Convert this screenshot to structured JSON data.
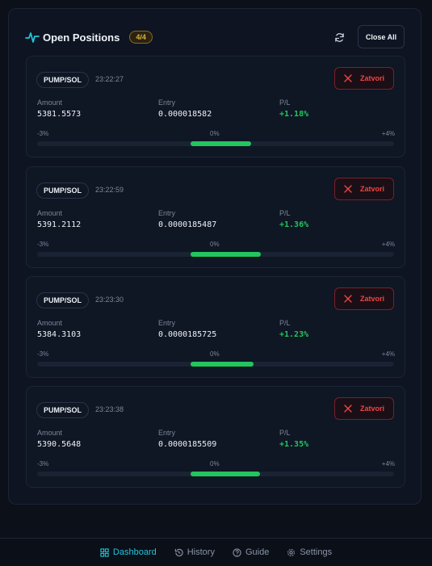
{
  "header": {
    "title": "Open Positions",
    "count": "4/4",
    "close_all_label": "Close All"
  },
  "positions": [
    {
      "pair": "PUMP/SOL",
      "time": "23:22:27",
      "amount_label": "Amount",
      "amount": "5381.5573",
      "entry_label": "Entry",
      "entry": "0.000018582",
      "pl_label": "P/L",
      "pl": "+1.18%",
      "pl_pct": 1.18,
      "close_label": "Zatvori",
      "scale_min": "-3%",
      "scale_zero": "0%",
      "scale_max": "+4%"
    },
    {
      "pair": "PUMP/SOL",
      "time": "23:22:59",
      "amount_label": "Amount",
      "amount": "5391.2112",
      "entry_label": "Entry",
      "entry": "0.0000185487",
      "pl_label": "P/L",
      "pl": "+1.36%",
      "pl_pct": 1.36,
      "close_label": "Zatvori",
      "scale_min": "-3%",
      "scale_zero": "0%",
      "scale_max": "+4%"
    },
    {
      "pair": "PUMP/SOL",
      "time": "23:23:30",
      "amount_label": "Amount",
      "amount": "5384.3103",
      "entry_label": "Entry",
      "entry": "0.0000185725",
      "pl_label": "P/L",
      "pl": "+1.23%",
      "pl_pct": 1.23,
      "close_label": "Zatvori",
      "scale_min": "-3%",
      "scale_zero": "0%",
      "scale_max": "+4%"
    },
    {
      "pair": "PUMP/SOL",
      "time": "23:23:38",
      "amount_label": "Amount",
      "amount": "5390.5648",
      "entry_label": "Entry",
      "entry": "0.0000185509",
      "pl_label": "P/L",
      "pl": "+1.35%",
      "pl_pct": 1.35,
      "close_label": "Zatvori",
      "scale_min": "-3%",
      "scale_zero": "0%",
      "scale_max": "+4%"
    }
  ],
  "nav": {
    "items": [
      {
        "label": "Dashboard",
        "icon": "grid-icon",
        "active": true
      },
      {
        "label": "History",
        "icon": "history-icon",
        "active": false
      },
      {
        "label": "Guide",
        "icon": "help-icon",
        "active": false
      },
      {
        "label": "Settings",
        "icon": "gear-icon",
        "active": false
      }
    ]
  },
  "colors": {
    "accent": "#22c5d9",
    "profit": "#22c55e",
    "danger": "#ef4444",
    "badge": "#e0b13a"
  }
}
